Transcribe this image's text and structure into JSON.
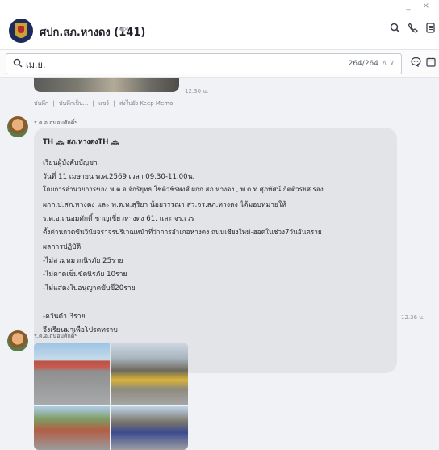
{
  "window": {
    "controls": "_ ×"
  },
  "header": {
    "title": "ศปก.สภ.หางดง (141)",
    "mute_icon": "speaker-muted-icon",
    "icons": [
      "search-icon",
      "phone-icon",
      "menu-icon"
    ]
  },
  "search": {
    "query": "เม.ย.",
    "count": "264/264",
    "arrows": "∧ ∨",
    "icons": [
      "search-icon",
      "chat-bubble-icon",
      "calendar-icon"
    ]
  },
  "messages": {
    "previous": {
      "time": "12.30 น.",
      "actions": [
        "บันทึก",
        "บันทึกเป็น...",
        "แชร์",
        "ส่งไปยัง Keep Memo"
      ],
      "separator": "|"
    },
    "text_message": {
      "sender": "ร.ต.อ.ถนอมศักดิ์ฯ",
      "time": "12.36 น.",
      "lines": [
        "TH 🚓 สภ.หางดงTH 🚓",
        "",
        "เรียนผู้บังคับบัญชา",
        "วันที่ 11 เมษายน พ.ศ.2569 เวลา 09.30-11.00น.",
        "โดยการอำนวยการของ พ.ต.อ.จักริยุทธ โชติวชิรพงศ์ ผกก.สภ.หางดง , พ.ต.ท.ศุภทัศน์ กิตติวรยศ รอง",
        "ผกก.ป.สภ.หางดง และ พ.ต.ท.สุริยา น้อยวรรณา สว.จร.สภ.หางดง ได้มอบหมายให้",
        "ร.ต.อ.ถนอมศักดิ์ ชาญเชี่ยวหางดง 61, และ จร.เวร",
        "ตั้งด่านกวดขันวินัยจราจรบริเวณหน้าที่ว่าการอำเภอหางดง ถนนเชียงใหม่-ฮอดในช่วง7วันอันตราย",
        "ผลการปฏิบัติ",
        "-ไม่สวมหมวกนิรภัย 25ราย",
        "-ไม่คาดเข็มขัดนิรภัย 10ราย",
        "-ไม่แสดงใบอนุญาตขับขี่20ราย",
        "",
        "-ควันดำ 3ราย",
        "จึงเรียนมาเพื่อโปรดทราบ"
      ]
    },
    "photo_message": {
      "sender": "ร.ต.อ.ถนอมศักดิ์ฯ",
      "photo_count": 4
    }
  }
}
